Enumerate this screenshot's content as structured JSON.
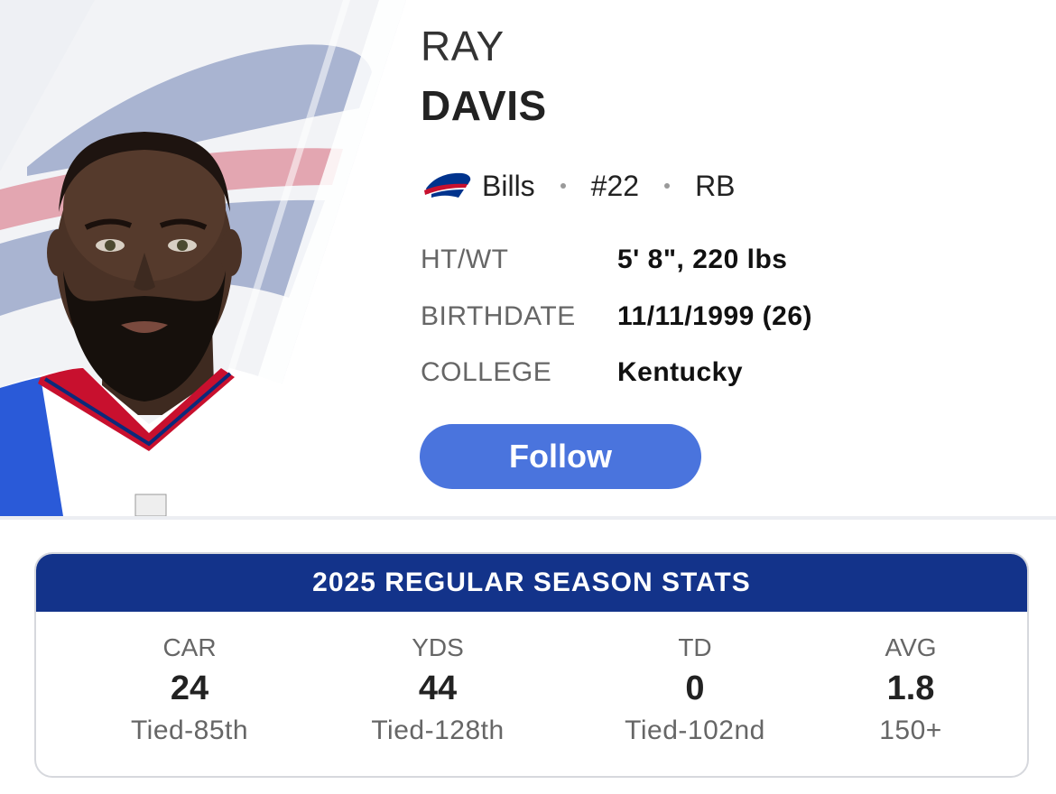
{
  "player": {
    "first_name": "RAY",
    "last_name": "DAVIS",
    "team": "Bills",
    "number": "#22",
    "position": "RB",
    "team_logo_icon": "bills-buffalo-logo-icon",
    "photo_icon": "player-headshot"
  },
  "info": [
    {
      "label": "HT/WT",
      "value": "5' 8\", 220 lbs"
    },
    {
      "label": "BIRTHDATE",
      "value": "11/11/1999 (26)"
    },
    {
      "label": "COLLEGE",
      "value": "Kentucky"
    }
  ],
  "follow_label": "Follow",
  "stats": {
    "title": "2025 REGULAR SEASON STATS",
    "columns": [
      {
        "label": "CAR",
        "value": "24",
        "rank": "Tied-85th"
      },
      {
        "label": "YDS",
        "value": "44",
        "rank": "Tied-128th"
      },
      {
        "label": "TD",
        "value": "0",
        "rank": "Tied-102nd"
      },
      {
        "label": "AVG",
        "value": "1.8",
        "rank": "150+"
      }
    ]
  },
  "colors": {
    "accent_blue": "#4a74dd",
    "header_navy": "#13338a",
    "bills_red": "#c8102e",
    "bills_blue": "#00338d"
  }
}
